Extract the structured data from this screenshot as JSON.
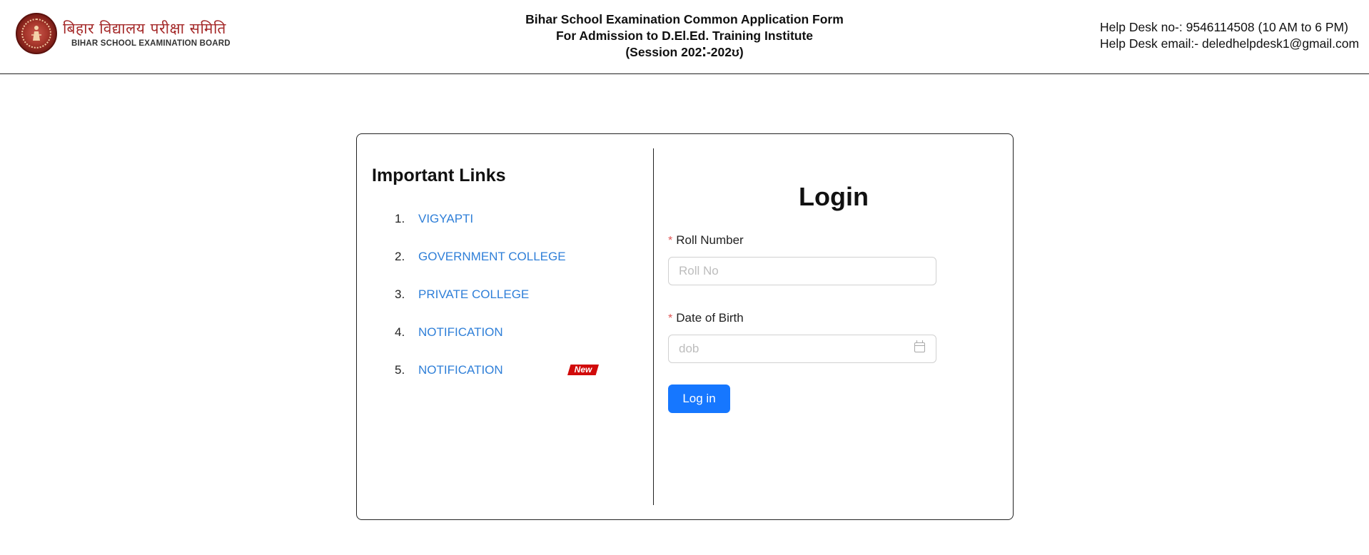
{
  "header": {
    "logo_hindi": "बिहार विद्यालय परीक्षा समिति",
    "logo_english": "BIHAR SCHOOL EXAMINATION BOARD",
    "title_line1": "Bihar School Examination Common Application Form",
    "title_line2": "For Admission to D.El.Ed. Training Institute",
    "title_line3": "(Session 202⁚-202ʊ)",
    "helpdesk_phone": "Help Desk no-: 9546114508 (10 AM to 6 PM)",
    "helpdesk_email": "Help Desk email:- deledhelpdesk1@gmail.com"
  },
  "links": {
    "title": "Important Links",
    "items": [
      {
        "num": "1.",
        "label": "VIGYAPTI"
      },
      {
        "num": "2.",
        "label": "GOVERNMENT COLLEGE"
      },
      {
        "num": "3.",
        "label": "PRIVATE COLLEGE"
      },
      {
        "num": "4.",
        "label": "NOTIFICATION"
      },
      {
        "num": "5.",
        "label": "NOTIFICATION",
        "badge": "New"
      }
    ]
  },
  "login": {
    "title": "Login",
    "roll_label": "Roll Number",
    "roll_placeholder": "Roll No",
    "dob_label": "Date of Birth",
    "dob_placeholder": "dob",
    "required_mark": "*",
    "button_label": "Log in"
  },
  "colors": {
    "link": "#2f7fd8",
    "primary_button": "#1677ff",
    "badge": "#d10a0a",
    "logo_text": "#a52a2a"
  },
  "icons": {
    "logo": "bseb-emblem-icon",
    "date": "calendar-icon"
  }
}
